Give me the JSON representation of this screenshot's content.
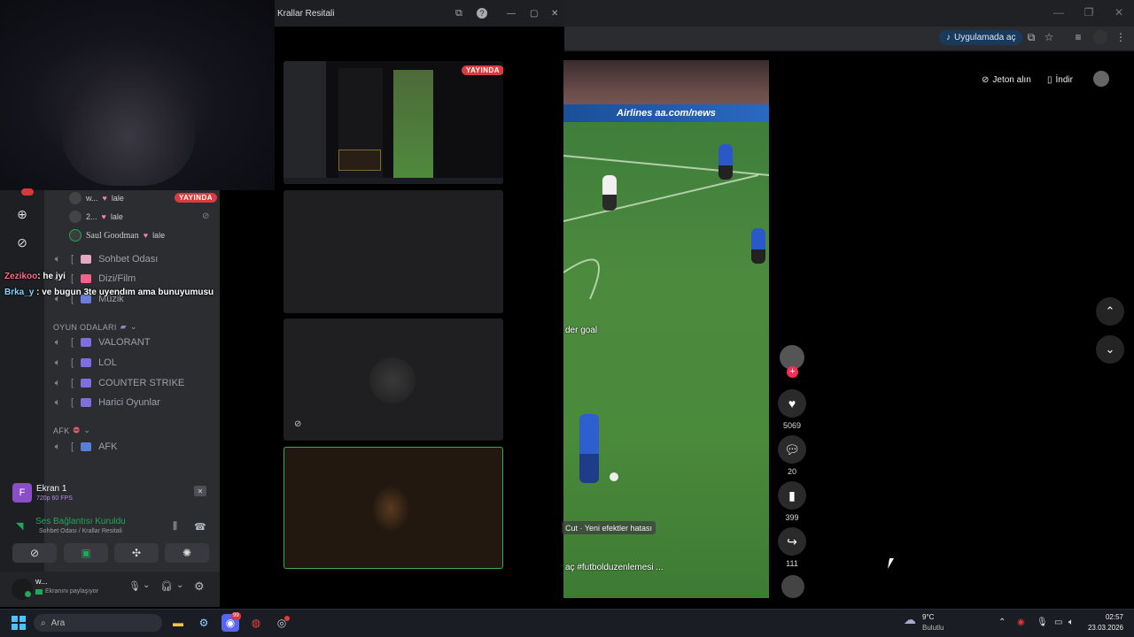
{
  "browser": {
    "open_in_app": "Uygulamada aç",
    "get_coins": "Jeton alın",
    "download": "İndir"
  },
  "stream_window": {
    "title": "Krallar Resitali",
    "live_badge": "YAYINDA"
  },
  "discord": {
    "live_badge": "YAYINDA",
    "voice_users": [
      {
        "name": "w...",
        "status": "lale"
      },
      {
        "name": "2...",
        "status": "lale"
      },
      {
        "name": "Saul Goodman",
        "status": "lale"
      }
    ],
    "channels": [
      {
        "bracket": "[",
        "name": "Sohbet Odası"
      },
      {
        "bracket": "[",
        "name": "Dizi/Film"
      },
      {
        "bracket": "[",
        "name": "Müzik"
      }
    ],
    "category_games": "OYUN ODALARI",
    "game_channels": [
      {
        "bracket": "[",
        "name": "VALORANT"
      },
      {
        "bracket": "[",
        "name": "LOL"
      },
      {
        "bracket": "[",
        "name": "COUNTER STRIKE"
      },
      {
        "bracket": "[",
        "name": "Harici Oyunlar"
      }
    ],
    "category_afk": "AFK",
    "afk_channel": {
      "bracket": "[",
      "name": "AFK"
    },
    "stream": {
      "title": "Ekran 1",
      "quality": "720p 60 FPS",
      "avatar_letter": "F"
    },
    "voice": {
      "status": "Ses Bağlantısı Kuruldu",
      "location": "Sohbet Odası / Krallar Resitali"
    },
    "user": {
      "name": "w...",
      "sub": "Ekranını paylaşıyor"
    }
  },
  "overlay_chat": [
    {
      "user": "Zezikoo",
      "text": ": he iyi"
    },
    {
      "user": "Brka_y",
      "text": " : ve bugun 3te uyendım ama bunuyumusu"
    }
  ],
  "tiktok": {
    "caption_fragment": "der goal",
    "capcut_label": "Cut · Yeni efektler hatası",
    "hashtags": "aç #futbolduzenlemesi ...",
    "likes": "5069",
    "comments": "20",
    "saves": "399",
    "shares": "111",
    "ad_text": "Airlines  aa.com/news"
  },
  "taskbar": {
    "search_placeholder": "Ara",
    "weather_temp": "9°C",
    "weather_desc": "Bulutlu",
    "time": "02:57",
    "date": "23.03.2026",
    "discord_badge": "99"
  },
  "colors": {
    "discord_bg": "#2b2d31",
    "live_red": "#d83c3e",
    "voice_green": "#23a55a",
    "tiktok_red": "#fe2c55"
  }
}
